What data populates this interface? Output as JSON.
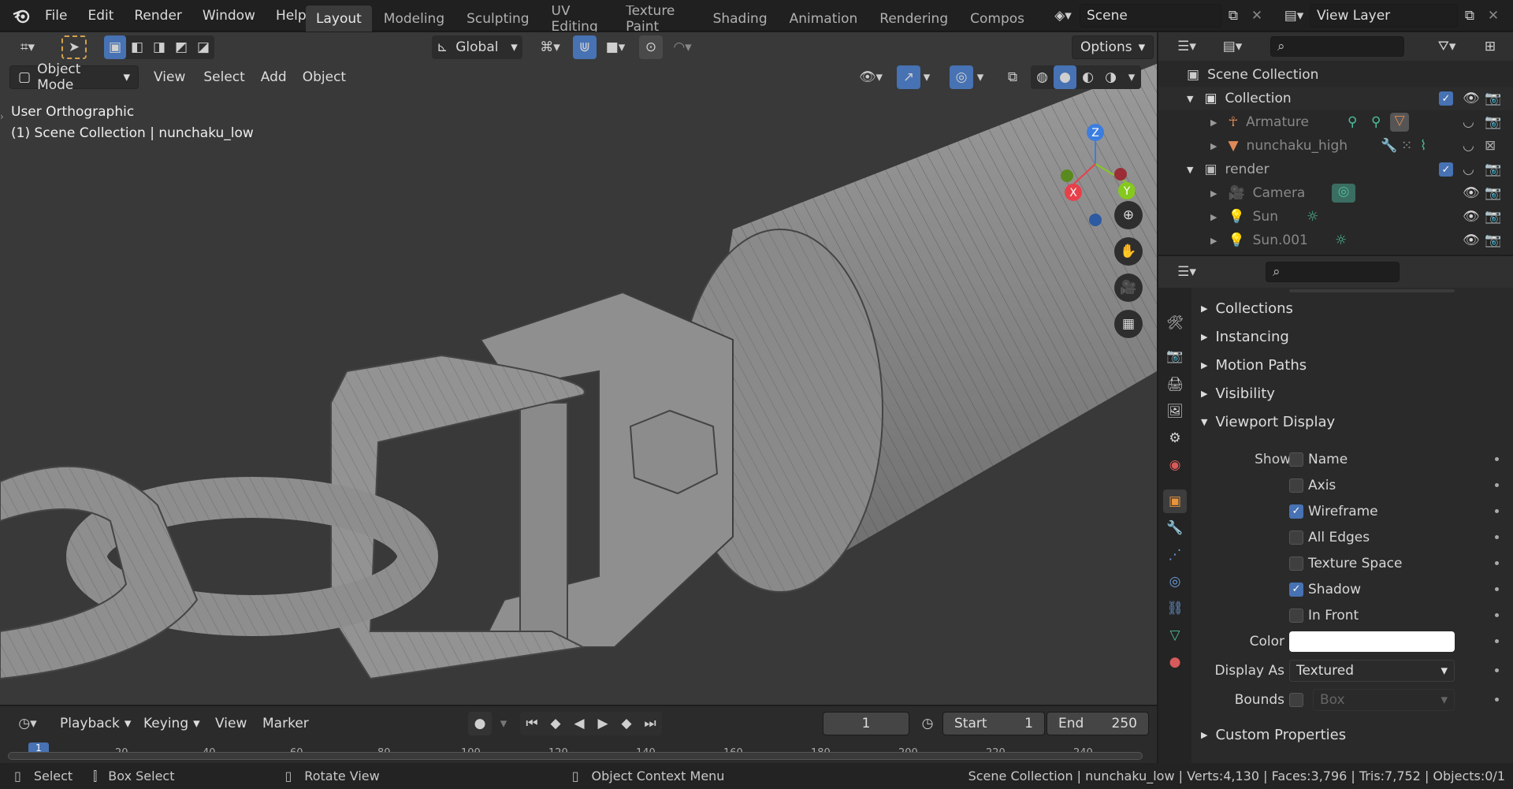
{
  "topbar": {
    "menus": [
      "File",
      "Edit",
      "Render",
      "Window",
      "Help"
    ],
    "workspaces": [
      "Layout",
      "Modeling",
      "Sculpting",
      "UV Editing",
      "Texture Paint",
      "Shading",
      "Animation",
      "Rendering",
      "Compos"
    ],
    "active_workspace": "Layout",
    "scene_name": "Scene",
    "view_layer": "View Layer"
  },
  "viewport": {
    "transform_orientation": "Global",
    "options_label": "Options",
    "mode": "Object Mode",
    "menus": [
      "View",
      "Select",
      "Add",
      "Object"
    ],
    "overlay_view": "User Orthographic",
    "overlay_object": "(1) Scene Collection | nunchaku_low",
    "gizmo_axes": [
      "Z",
      "Y",
      "X"
    ]
  },
  "outliner": {
    "search_placeholder": "",
    "root": "Scene Collection",
    "items": [
      {
        "label": "Collection",
        "depth": 1,
        "type": "collection"
      },
      {
        "label": "Armature",
        "depth": 2,
        "type": "armature"
      },
      {
        "label": "nunchaku_high",
        "depth": 2,
        "type": "mesh"
      },
      {
        "label": "render",
        "depth": 1,
        "type": "collection"
      },
      {
        "label": "Camera",
        "depth": 2,
        "type": "camera"
      },
      {
        "label": "Sun",
        "depth": 2,
        "type": "light"
      },
      {
        "label": "Sun.001",
        "depth": 2,
        "type": "light"
      }
    ]
  },
  "properties": {
    "panels": [
      "Collections",
      "Instancing",
      "Motion Paths",
      "Visibility",
      "Viewport Display",
      "Custom Properties"
    ],
    "show_label": "Show",
    "checkboxes": [
      {
        "label": "Name",
        "checked": false
      },
      {
        "label": "Axis",
        "checked": false
      },
      {
        "label": "Wireframe",
        "checked": true
      },
      {
        "label": "All Edges",
        "checked": false
      },
      {
        "label": "Texture Space",
        "checked": false
      },
      {
        "label": "Shadow",
        "checked": true
      },
      {
        "label": "In Front",
        "checked": false
      }
    ],
    "color_label": "Color",
    "color_value": "#ffffff",
    "display_as_label": "Display As",
    "display_as_value": "Textured",
    "bounds_label": "Bounds",
    "bounds_value": "Box"
  },
  "timeline": {
    "menus": [
      "Playback",
      "Keying",
      "View",
      "Marker"
    ],
    "current_frame": "1",
    "start_label": "Start",
    "start_value": "1",
    "end_label": "End",
    "end_value": "250",
    "ruler_ticks": [
      "20",
      "40",
      "60",
      "80",
      "100",
      "120",
      "140",
      "160",
      "180",
      "200",
      "220",
      "240"
    ],
    "ruler_current": "1"
  },
  "statusbar": {
    "select": "Select",
    "box_select": "Box Select",
    "rotate_view": "Rotate View",
    "context_menu": "Object Context Menu",
    "stats": "Scene Collection | nunchaku_low | Verts:4,130 | Faces:3,796 | Tris:7,752 | Objects:0/1"
  },
  "colors": {
    "accent": "#4772b3",
    "header_bg": "#303030",
    "viewport_bg": "#393939",
    "axis_x": "#e8404a",
    "axis_y": "#85c91e",
    "axis_z": "#3b7ee0"
  }
}
